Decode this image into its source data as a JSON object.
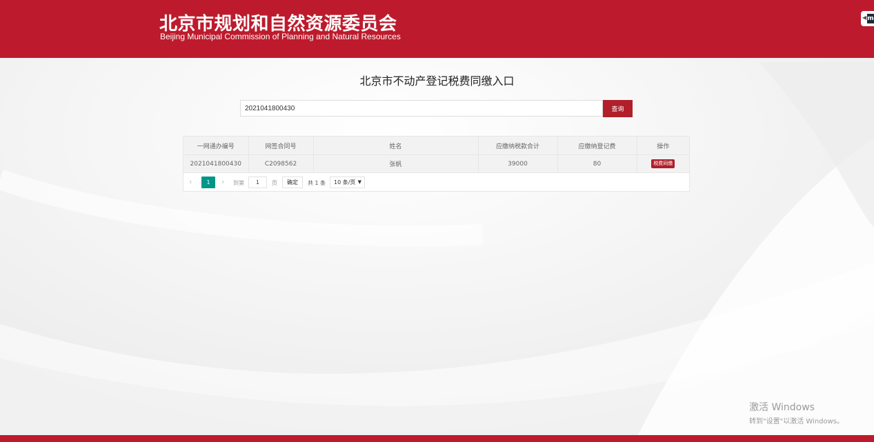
{
  "header": {
    "title_cn": "北京市规划和自然资源委员会",
    "title_en": "Beijing Municipal Commission of Planning and Natural Resources",
    "brand_color": "#bd1b2d",
    "widget_letter": "m"
  },
  "page": {
    "title": "北京市不动产登记税费同缴入口"
  },
  "search": {
    "value": "2021041800430",
    "button_label": "查询"
  },
  "table": {
    "columns": [
      "一网通办编号",
      "网签合同号",
      "姓名",
      "应缴纳税款合计",
      "应缴纳登记费",
      "操作"
    ],
    "rows": [
      {
        "id": "2021041800430",
        "contract": "C2098562",
        "name": "张帆",
        "tax_total": "39000",
        "registration_fee": "80",
        "action_label": "税费同缴"
      }
    ]
  },
  "pager": {
    "current_page": "1",
    "goto_label": "到第",
    "goto_value": "1",
    "page_label": "页",
    "confirm_label": "确定",
    "total_label": "共 1 条",
    "page_size_label": "10 条/页"
  },
  "watermark": {
    "line1": "激活 Windows",
    "line2": "转到\"设置\"以激活 Windows。"
  }
}
